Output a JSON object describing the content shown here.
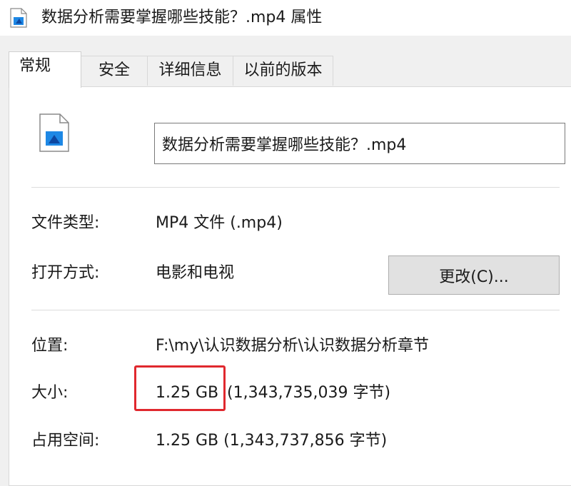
{
  "window": {
    "title": "数据分析需要掌握哪些技能？.mp4 属性"
  },
  "tabs": [
    {
      "label": "常规",
      "active": true
    },
    {
      "label": "安全",
      "active": false
    },
    {
      "label": "详细信息",
      "active": false
    },
    {
      "label": "以前的版本",
      "active": false
    }
  ],
  "general": {
    "file_name": "数据分析需要掌握哪些技能？.mp4",
    "type_label": "文件类型:",
    "type_value": "MP4 文件 (.mp4)",
    "opens_with_label": "打开方式:",
    "opens_with_value": "电影和电视",
    "change_button": "更改(C)...",
    "location_label": "位置:",
    "location_value": "F:\\my\\认识数据分析\\认识数据分析章节",
    "size_label": "大小:",
    "size_value": "1.25 GB",
    "size_bytes": "(1,343,735,039 字节)",
    "disk_label": "占用空间:",
    "disk_value": "1.25 GB (1,343,737,856 字节)"
  },
  "colors": {
    "highlight": "#e0282e",
    "icon_blue": "#1e88e5"
  },
  "icons": {
    "title_icon": "video-file-icon",
    "file_icon": "video-file-icon"
  }
}
